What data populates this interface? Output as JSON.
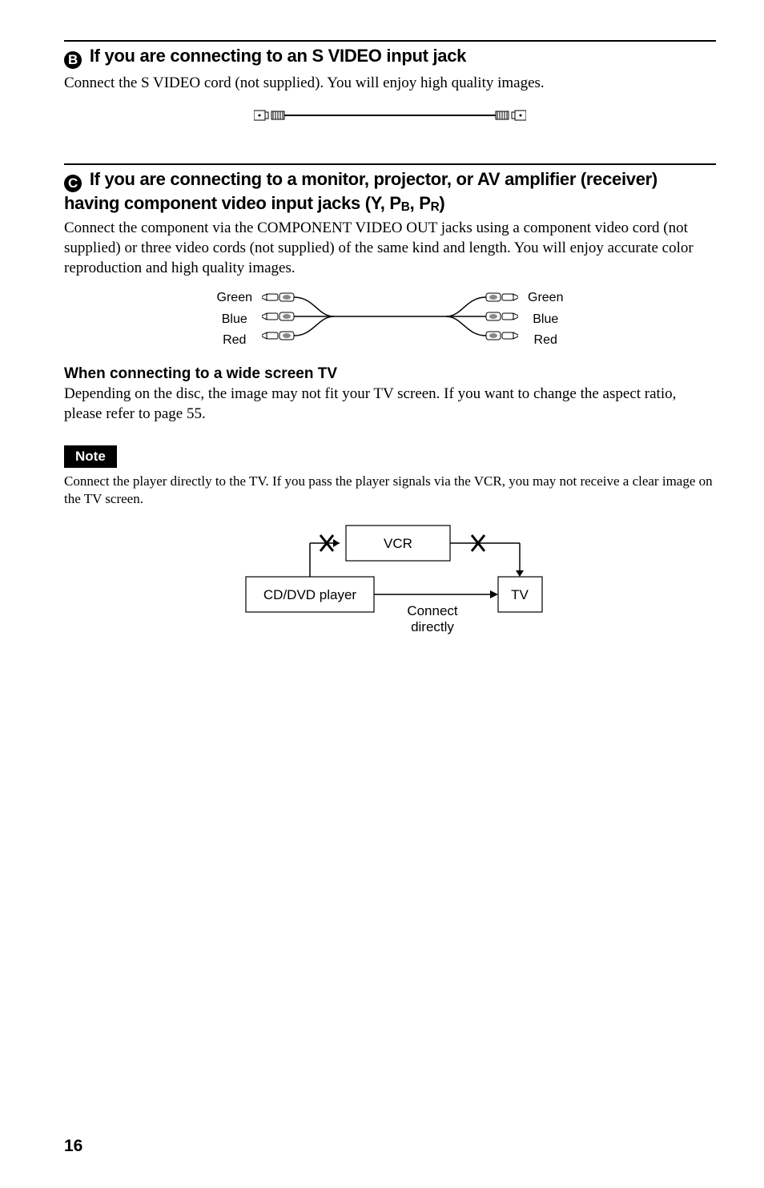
{
  "sectionB": {
    "letter": "B",
    "heading": "If you are connecting to an S VIDEO input jack",
    "body": "Connect the S VIDEO cord (not supplied). You will enjoy high quality images."
  },
  "sectionC": {
    "letter": "C",
    "heading_line1": "If you are connecting to a monitor, projector, or AV amplifier (receiver)",
    "heading_line2_prefix": "having component video input jacks (Y, P",
    "heading_line2_mid": ", P",
    "heading_line2_suffix": ")",
    "sub_b": "B",
    "sub_r": "R",
    "body": "Connect the component via the COMPONENT VIDEO OUT jacks using a component video cord (not supplied) or three video cords (not supplied) of the same kind and length. You will enjoy accurate color reproduction and high quality images."
  },
  "component_labels": {
    "green": "Green",
    "blue": "Blue",
    "red": "Red"
  },
  "wide": {
    "heading": "When connecting to a wide screen TV",
    "body": "Depending on the disc, the image may not fit your TV screen. If you want to change the aspect ratio, please refer to page 55."
  },
  "note": {
    "label": "Note",
    "body": "Connect the player directly to the TV. If you pass the player signals via the VCR, you may not receive a clear image on the TV screen."
  },
  "flow": {
    "player": "CD/DVD player",
    "vcr": "VCR",
    "tv": "TV",
    "connect1": "Connect",
    "connect2": "directly"
  },
  "page": "16"
}
